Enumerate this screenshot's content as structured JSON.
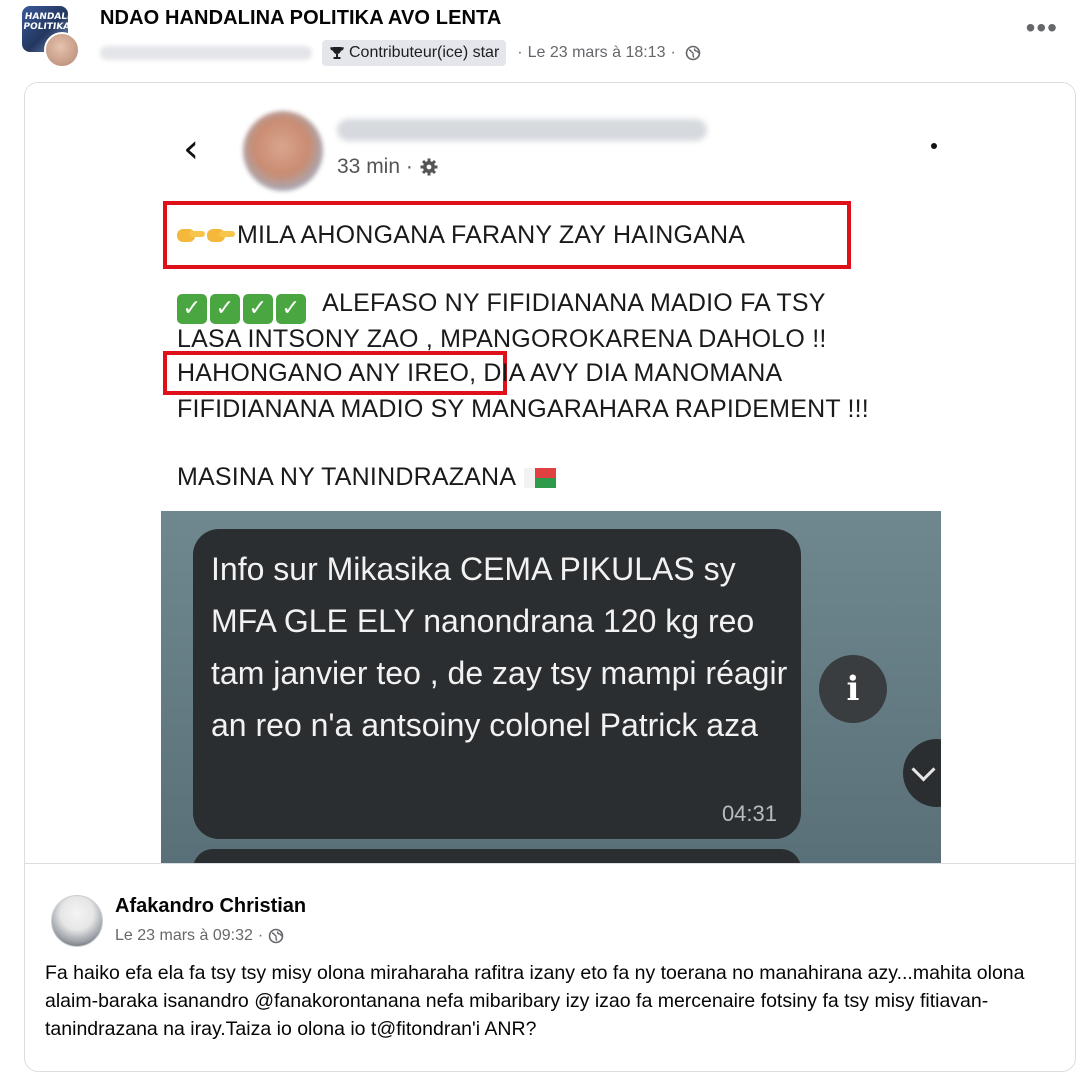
{
  "post": {
    "group_name": "NDAO HANDALINA POLITIKA AVO LENTA",
    "group_avatar_text": "HANDALINA POLITIKA",
    "badge_label": "Contributeur(ice) star",
    "timestamp": "Le 23 mars à 18:13",
    "separator": "·",
    "more_label": "•••"
  },
  "screenshot": {
    "back_glyph": "‹",
    "time_label": "33 min ·",
    "headline": "MILA AHONGANA FARANY ZAY HAINGANA",
    "body_line1": "ALEFASO NY FIFIDIANANA MADIO FA TSY",
    "body_line2": "LASA INTSONY ZAO , MPANGOROKARENA DAHOLO !!",
    "body_line3_highlight": "HAHONGANO ANY IREO",
    "body_line3_rest": ", DIA AVY DIA MANOMANA",
    "body_line4": "FIFIDIANANA MADIO SY MANGARAHARA RAPIDEMENT !!!",
    "closing": "MASINA NY TANINDRAZANA",
    "check_glyph": "✓",
    "chat": {
      "message": "Info sur Mikasika CEMA PIKULAS sy MFA GLE ELY nanondrana 120 kg reo tam janvier teo , de zay tsy mampi réagir an reo n'a antsoiny colonel Patrick aza",
      "time": "04:31",
      "info_glyph": "i"
    }
  },
  "original_post": {
    "author": "Afakandro Christian",
    "timestamp": "Le 23 mars à 09:32",
    "separator": "·",
    "text": "Fa haiko efa ela fa tsy tsy misy olona miraharaha rafitra izany eto fa ny toerana no manahirana azy...mahita olona alaim-baraka isanandro @fanakorontanana nefa mibaribary izy izao fa mercenaire fotsiny fa tsy misy fitiavan-tanindrazana na iray.Taiza io olona io t@fitondran'i ANR?"
  },
  "colors": {
    "highlight_box": "#e0101a",
    "meta_text": "#65676b",
    "check_green": "#4aa640",
    "chat_bubble": "#2b2e30"
  },
  "icons": [
    "trophy-icon",
    "globe-icon",
    "more-options-icon",
    "back-arrow-icon",
    "settings-gear-icon",
    "pointing-hand-emoji",
    "check-mark-emoji",
    "madagascar-flag-emoji",
    "info-icon",
    "scroll-down-icon"
  ]
}
